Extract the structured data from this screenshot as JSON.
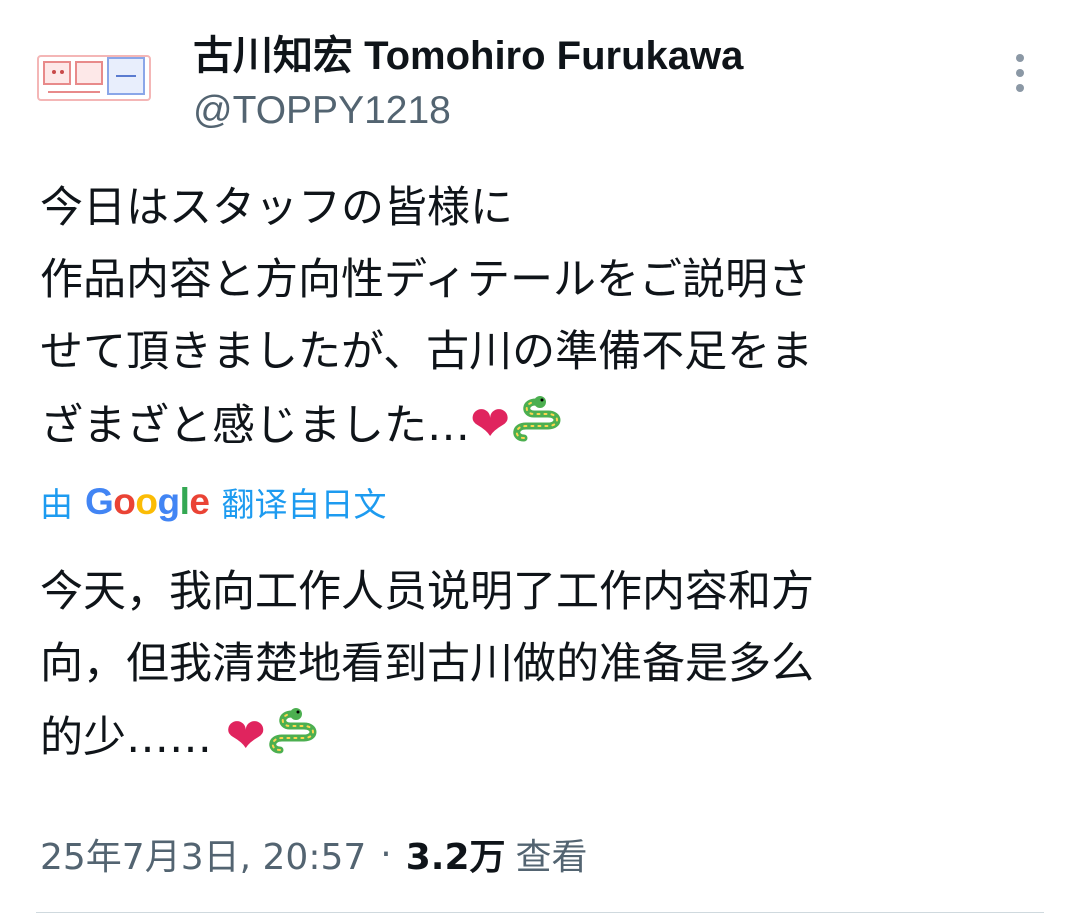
{
  "author": {
    "display_name": "古川知宏 Tomohiro Furukawa",
    "handle": "@TOPPY1218",
    "avatar_icon": "avatar-icon"
  },
  "more_icon": "more-vertical-icon",
  "post": {
    "lines": [
      "今日はスタッフの皆様に",
      "作品内容と方向性ディテールをご説明さ",
      "せて頂きましたが、古川の準備不足をま",
      "ざまざと感じました…"
    ],
    "emojis": [
      "heart-emoji",
      "snake-emoji"
    ]
  },
  "translation": {
    "prefix": "由",
    "provider": "Google",
    "link_label": "翻译自日文",
    "lines": [
      "今天，我向工作人员说明了工作内容和方",
      "向，但我清楚地看到古川做的准备是多么",
      "的少……"
    ]
  },
  "meta": {
    "date": "25年7月3日, 20:57",
    "separator": "·",
    "views_count": "3.2万",
    "views_label": "查看"
  },
  "colors": {
    "text": "#0f1419",
    "secondary": "#536471",
    "link": "#1d9bf0",
    "heart": "#e0245e",
    "snake": "#4caf50"
  }
}
